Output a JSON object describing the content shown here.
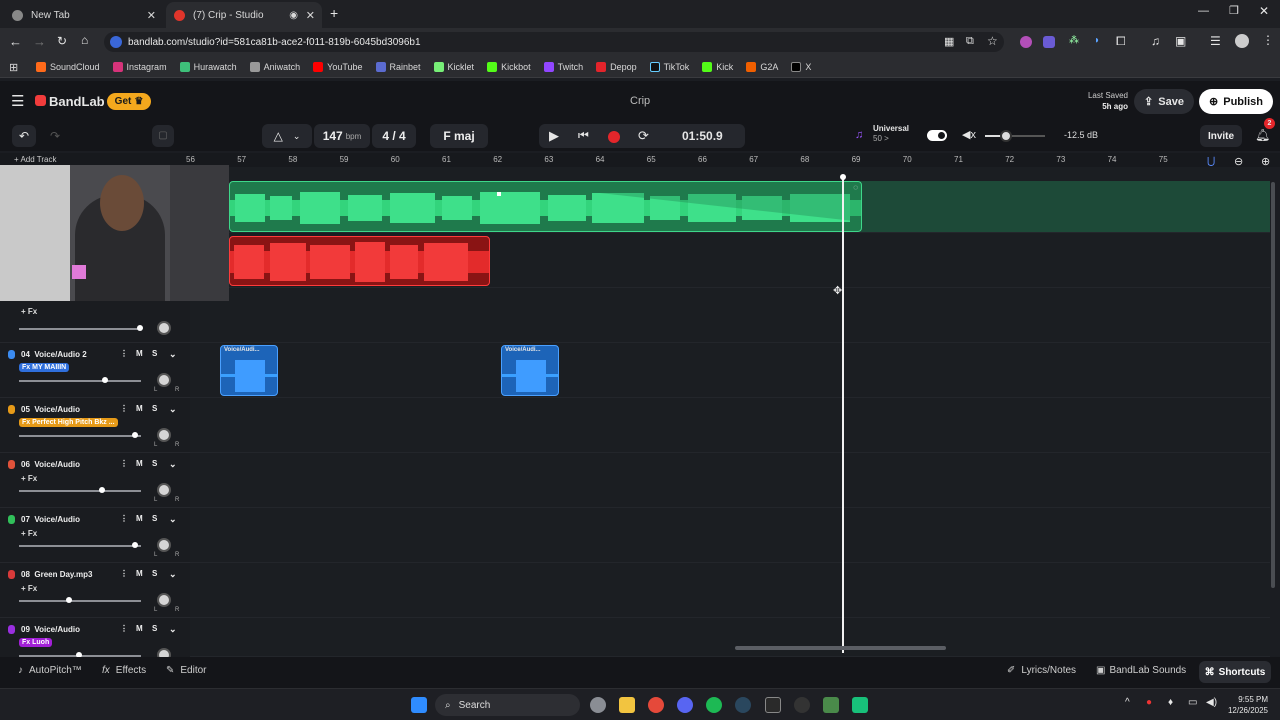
{
  "browser": {
    "tabs": [
      {
        "title": "New Tab",
        "active": false
      },
      {
        "title": "(7) Crip - Studio",
        "active": true
      }
    ],
    "url": "bandlab.com/studio?id=581ca81b-ace2-f011-819b-6045bd3096b1",
    "bookmarks": [
      "SoundCloud",
      "Instagram",
      "Hurawatch",
      "Aniwatch",
      "YouTube",
      "Rainbet",
      "Kicklet",
      "Kickbot",
      "Twitch",
      "Depop",
      "TikTok",
      "Kick",
      "G2A",
      "X"
    ]
  },
  "app": {
    "logo": "BandLab",
    "get_label": "Get",
    "project_title": "Crip",
    "last_saved_label": "Last Saved",
    "last_saved_time": "5h ago",
    "save_label": "Save",
    "publish_label": "Publish",
    "invite_label": "Invite",
    "notif_count": "2"
  },
  "transport": {
    "bpm": "147",
    "bpm_unit": "bpm",
    "time_sig": "4 / 4",
    "key": "F maj",
    "time": "01:50.9",
    "preset_name": "Universal",
    "preset_sub": "50 >",
    "volume_db": "-12.5 dB",
    "volume_level": 0.35
  },
  "ruler": [
    "56",
    "57",
    "58",
    "59",
    "60",
    "61",
    "62",
    "63",
    "64",
    "65",
    "66",
    "67",
    "68",
    "69",
    "70",
    "71",
    "72",
    "73",
    "74",
    "75"
  ],
  "add_track_label": "Add Track",
  "tracks": [
    {
      "num": "04",
      "name": "Voice/Audio 2",
      "fx": "Fx MY MAIIIN",
      "fx_color": "#2f6fdc",
      "icon_color": "#3b8bf0",
      "vol": 0.72,
      "clips": [
        "Voice/Audi...",
        "Voice/Audi..."
      ]
    },
    {
      "num": "05",
      "name": "Voice/Audio",
      "fx": "Fx Perfect High Pitch Bkz ...",
      "fx_color": "#e69a18",
      "icon_color": "#e69a18",
      "vol": 0.97
    },
    {
      "num": "06",
      "name": "Voice/Audio",
      "fx": "+ Fx",
      "fx_color": "",
      "icon_color": "#e0523a",
      "vol": 0.69
    },
    {
      "num": "07",
      "name": "Voice/Audio",
      "fx": "+ Fx",
      "fx_color": "",
      "icon_color": "#31c05a",
      "vol": 0.97
    },
    {
      "num": "08",
      "name": "Green Day.mp3",
      "fx": "+ Fx",
      "fx_color": "",
      "icon_color": "#d83a3a",
      "vol": 0.42
    },
    {
      "num": "09",
      "name": "Voice/Audio",
      "fx": "Fx Luoh",
      "fx_color": "#a21fd6",
      "icon_color": "#9a2fe0",
      "vol": 0.5
    }
  ],
  "track03_fx": "+ Fx",
  "track_mute": "M",
  "track_solo": "S",
  "bottom": {
    "autopitch": "AutoPitch™",
    "effects": "Effects",
    "editor": "Editor",
    "lyrics": "Lyrics/Notes",
    "sounds": "BandLab Sounds",
    "shortcuts": "Shortcuts"
  },
  "taskbar": {
    "search_label": "Search",
    "time": "9:55 PM",
    "date": "12/26/2025"
  }
}
